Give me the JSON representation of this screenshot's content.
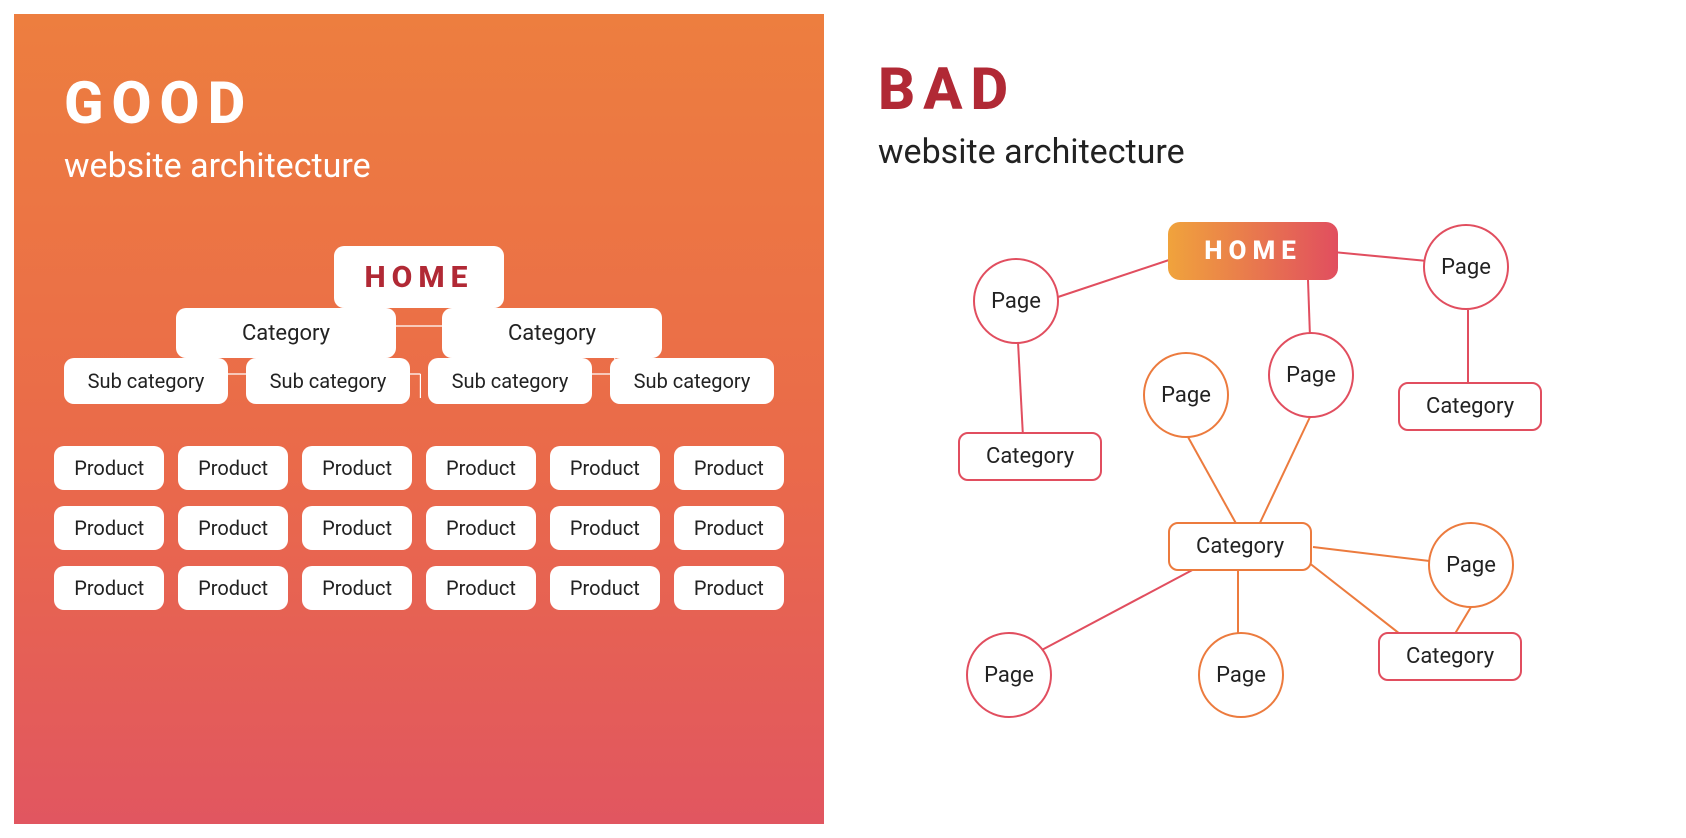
{
  "good": {
    "title": "GOOD",
    "subtitle": "website architecture",
    "home": "HOME",
    "categories": [
      "Category",
      "Category"
    ],
    "subcategories": [
      "Sub category",
      "Sub category",
      "Sub category",
      "Sub category"
    ],
    "products": [
      [
        "Product",
        "Product",
        "Product",
        "Product",
        "Product",
        "Product"
      ],
      [
        "Product",
        "Product",
        "Product",
        "Product",
        "Product",
        "Product"
      ],
      [
        "Product",
        "Product",
        "Product",
        "Product",
        "Product",
        "Product"
      ]
    ]
  },
  "bad": {
    "title": "BAD",
    "subtitle": "website architecture",
    "home": "HOME",
    "nodes": {
      "p1": "Page",
      "p2": "Page",
      "p3": "Page",
      "p4": "Page",
      "p5": "Page",
      "p6": "Page",
      "p7": "Page",
      "c1": "Category",
      "c2": "Category",
      "c3": "Category",
      "c4": "Category"
    }
  },
  "colors": {
    "orange": "#ec7b3e",
    "red": "#e14e5f",
    "darkred": "#b12935"
  }
}
